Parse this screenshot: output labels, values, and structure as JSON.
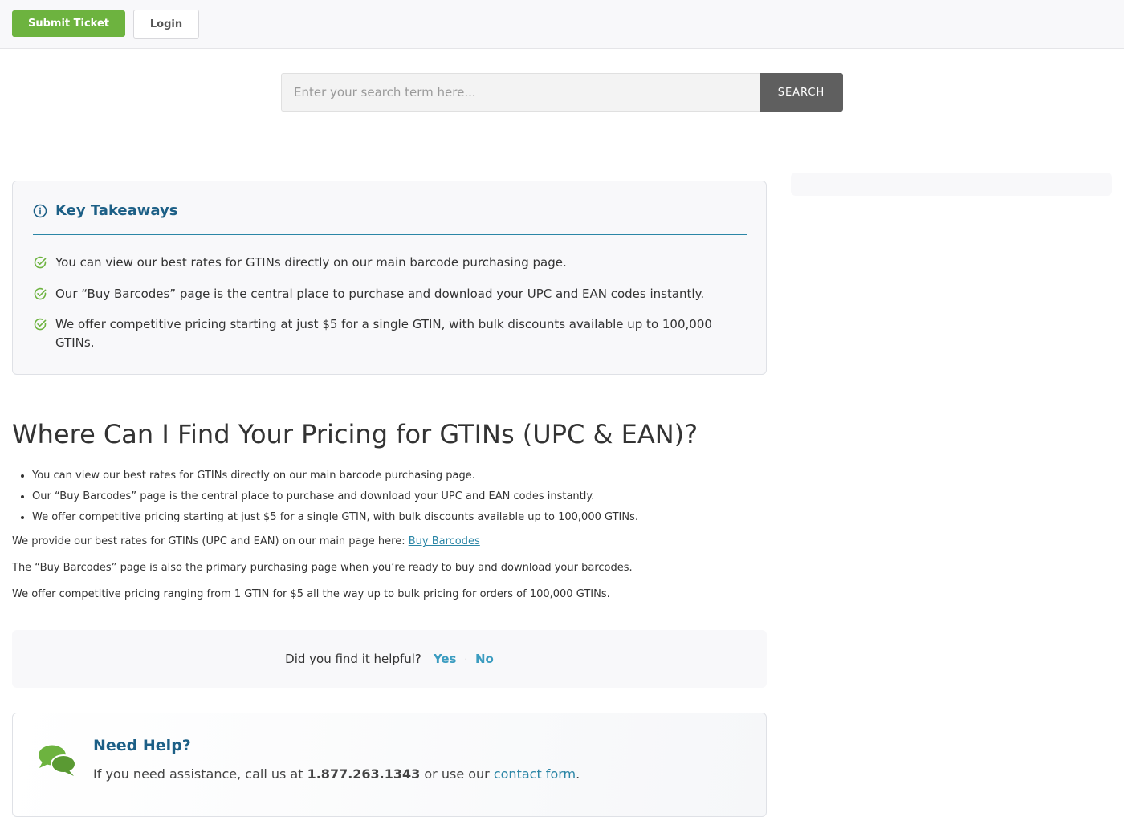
{
  "topbar": {
    "submit_label": "Submit Ticket",
    "login_label": "Login"
  },
  "search": {
    "placeholder": "Enter your search term here...",
    "button_label": "SEARCH"
  },
  "takeaways": {
    "title": "Key Takeaways",
    "items": [
      "You can view our best rates for GTINs directly on our main barcode purchasing page.",
      "Our “Buy Barcodes” page is the central place to purchase and download your UPC and EAN codes instantly.",
      "We offer competitive pricing starting at just $5 for a single GTIN, with bulk discounts available up to 100,000 GTINs."
    ]
  },
  "article": {
    "title": "Where Can I Find Your Pricing for GTINs (UPC & EAN)?",
    "bullets": [
      "You can view our best rates for GTINs directly on our main barcode purchasing page.",
      "Our “Buy Barcodes” page is the central place to purchase and download your UPC and EAN codes instantly.",
      "We offer competitive pricing starting at just $5 for a single GTIN, with bulk discounts available up to 100,000 GTINs."
    ],
    "para1_text": "We provide our best rates for GTINs (UPC and EAN) on our main page here: ",
    "para1_link": "Buy Barcodes",
    "para2": "The “Buy Barcodes” page is also the primary purchasing page when you’re ready to buy and download your barcodes.",
    "para3": "We offer competitive pricing ranging from 1 GTIN for $5 all the way up to bulk pricing for orders of 100,000 GTINs."
  },
  "feedback": {
    "question": "Did you find it helpful?",
    "yes": "Yes",
    "separator": "·",
    "no": "No"
  },
  "need_help": {
    "title": "Need Help?",
    "text_before": "If you need assistance, call us at ",
    "phone": "1.877.263.1343",
    "text_middle": " or use our ",
    "link": "contact form",
    "text_after": "."
  },
  "colors": {
    "accent_green": "#6db33f",
    "heading_blue": "#1c5f86",
    "link_blue": "#2b86a6"
  }
}
